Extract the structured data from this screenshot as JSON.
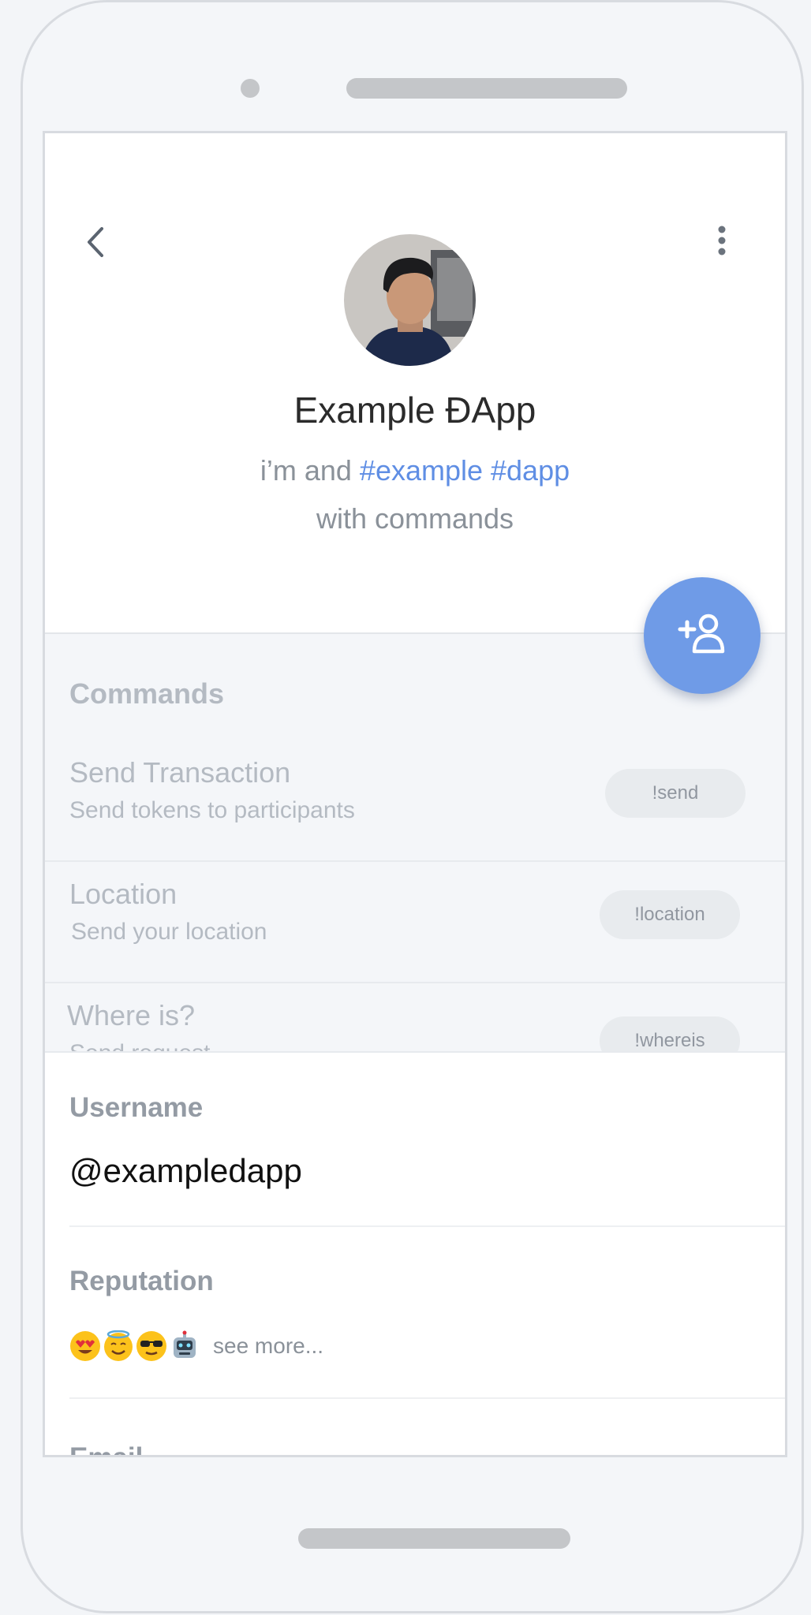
{
  "profile": {
    "name": "Example ĐApp",
    "bio_prefix": "i’m and ",
    "bio_tags": "#example #dapp",
    "bio_line2": "with commands"
  },
  "commands": {
    "title": "Commands",
    "items": [
      {
        "title": "Send Transaction",
        "desc": "Send tokens to participants",
        "command": "!send"
      },
      {
        "title": "Location",
        "desc": "Send your location",
        "command": "!location"
      },
      {
        "title": "Where is?",
        "desc": "Send request",
        "command": "!whereis"
      }
    ]
  },
  "info": {
    "username_label": "Username",
    "username": "@exampledapp",
    "reputation_label": "Reputation",
    "see_more": "see more...",
    "next_label": "Email"
  },
  "icons": {
    "back": "chevron-left-icon",
    "more": "more-vertical-icon",
    "fab": "add-contact-icon"
  },
  "colors": {
    "accent": "#6f9be7",
    "link": "#5f8ee4"
  }
}
